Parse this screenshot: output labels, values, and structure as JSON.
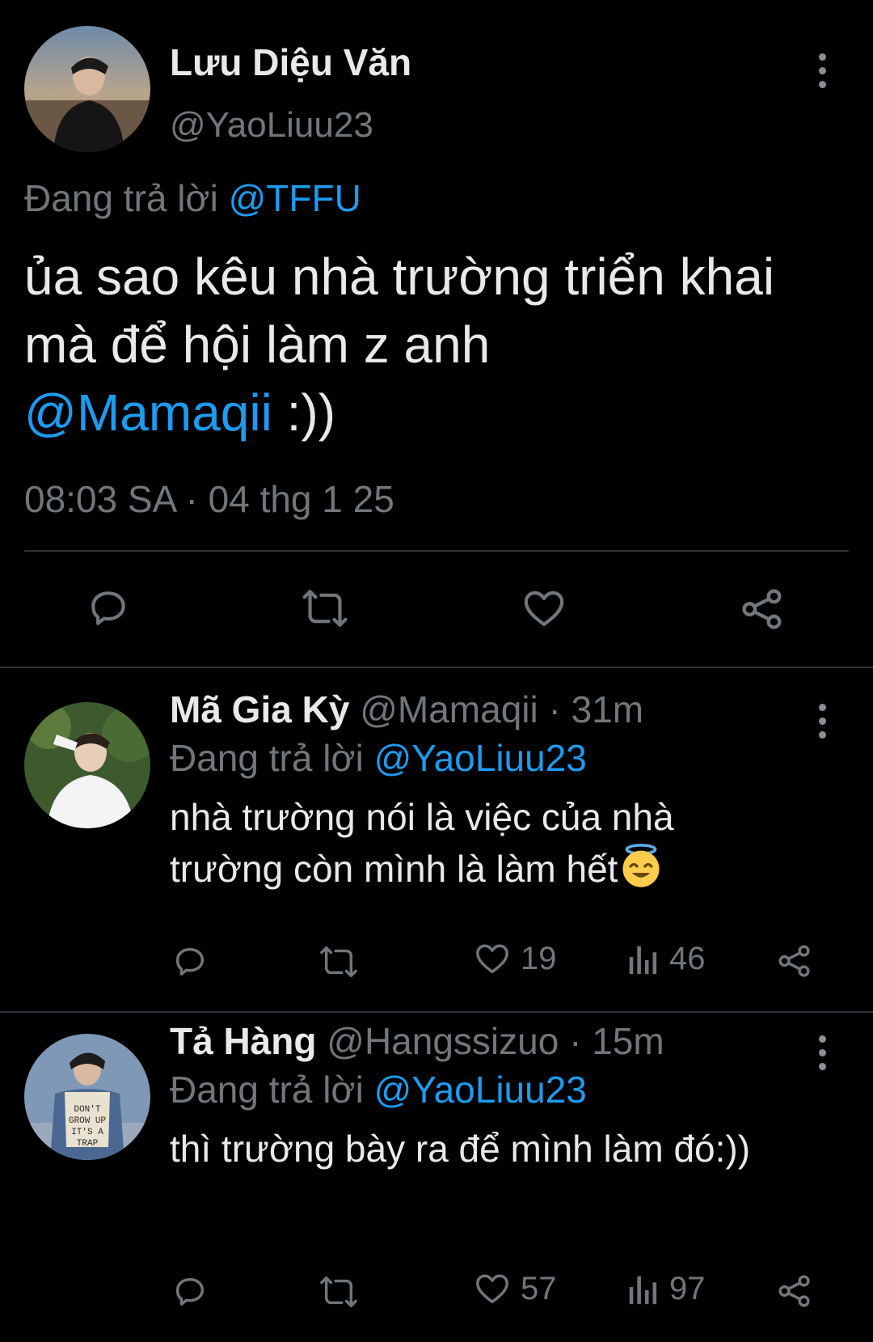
{
  "main_tweet": {
    "author_name": "Lưu Diệu Văn",
    "author_handle": "@YaoLiuu23",
    "replying_prefix": "Đang trả lời",
    "replying_to": "@TFFU",
    "text": "ủa sao kêu nhà trường triển khai mà để hội làm z anh",
    "text_mention": "@Mamaqii",
    "text_suffix": " :))",
    "timestamp": "08:03 SA · 04 thg 1 25",
    "actions": [
      "reply-icon",
      "retweet-icon",
      "like-icon",
      "share-icon"
    ]
  },
  "replies": [
    {
      "author_name": "Mã Gia Kỳ",
      "author_handle": "@Mamaqii",
      "age": "31m",
      "replying_prefix": "Đang trả lời",
      "replying_to": "@YaoLiuu23",
      "text": "nhà trường nói là việc của nhà trường còn mình là làm hết",
      "emoji": "smiling-face-with-halo",
      "likes": "19",
      "views": "46"
    },
    {
      "author_name": "Tả Hàng",
      "author_handle": "@Hangssizuo",
      "age": "15m",
      "replying_prefix": "Đang trả lời",
      "replying_to": "@YaoLiuu23",
      "text": "thì trường bày ra để mình làm đó:))",
      "likes": "57",
      "views": "97"
    }
  ],
  "colors": {
    "background": "#000000",
    "text": "#e7e9ea",
    "secondary": "#71767b",
    "link": "#1d9bf0",
    "divider": "#2f3336"
  }
}
